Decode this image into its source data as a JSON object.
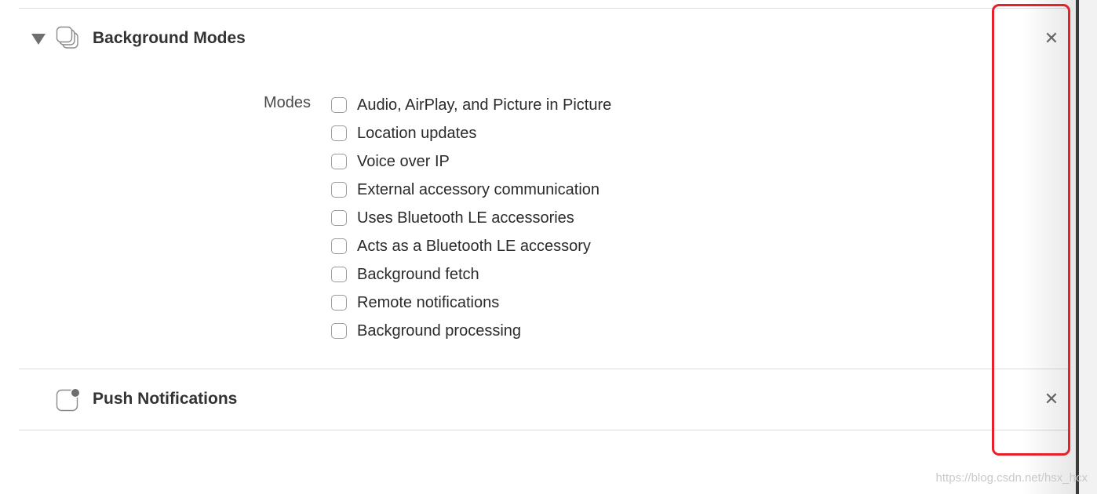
{
  "background_modes": {
    "title": "Background Modes",
    "icon": "stacked-windows-icon",
    "expanded": true,
    "close_symbol": "✕",
    "modes_label": "Modes",
    "modes": [
      {
        "label": "Audio, AirPlay, and Picture in Picture",
        "checked": false
      },
      {
        "label": "Location updates",
        "checked": false
      },
      {
        "label": "Voice over IP",
        "checked": false
      },
      {
        "label": "External accessory communication",
        "checked": false
      },
      {
        "label": "Uses Bluetooth LE accessories",
        "checked": false
      },
      {
        "label": "Acts as a Bluetooth LE accessory",
        "checked": false
      },
      {
        "label": "Background fetch",
        "checked": false
      },
      {
        "label": "Remote notifications",
        "checked": false
      },
      {
        "label": "Background processing",
        "checked": false
      }
    ]
  },
  "push_notifications": {
    "title": "Push Notifications",
    "icon": "notification-badge-icon",
    "close_symbol": "✕"
  },
  "highlight_color": "#e8202a",
  "watermark": "https://blog.csdn.net/hsx_hcx"
}
